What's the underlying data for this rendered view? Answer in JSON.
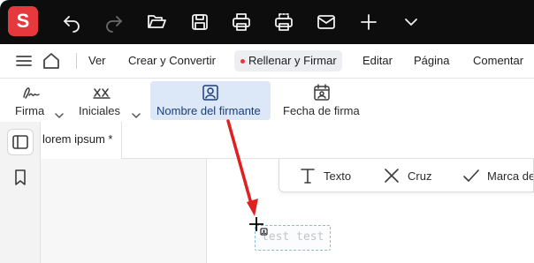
{
  "app": {
    "logo_letter": "S",
    "brand_color": "#e5393d"
  },
  "titlebar": {
    "icons": [
      "undo-icon",
      "redo-icon",
      "open-folder-icon",
      "save-icon",
      "print-icon",
      "print-preview-icon",
      "mail-icon",
      "plus-icon",
      "chevron-down-icon"
    ]
  },
  "menu": {
    "items": [
      "Ver",
      "Crear y Convertir",
      "Rellenar y Firmar",
      "Editar",
      "Página",
      "Comentar"
    ],
    "active_item": "Rellenar y Firmar"
  },
  "toolbar": {
    "firma_label": "Firma",
    "iniciales_label": "Iniciales",
    "nombre_label": "Nombre del firmante",
    "fecha_label": "Fecha de firma",
    "selected_tool": "Nombre del firmante"
  },
  "document": {
    "tab_title": "lorem ipsum *"
  },
  "annotation_toolbar": {
    "texto_label": "Texto",
    "cruz_label": "Cruz",
    "marca_label": "Marca de"
  },
  "signature_field": {
    "placeholder": "test test"
  },
  "colors": {
    "selection_bg": "#dce7f7",
    "arrow": "#e02020",
    "titlebar_bg": "#0d0d0d"
  }
}
